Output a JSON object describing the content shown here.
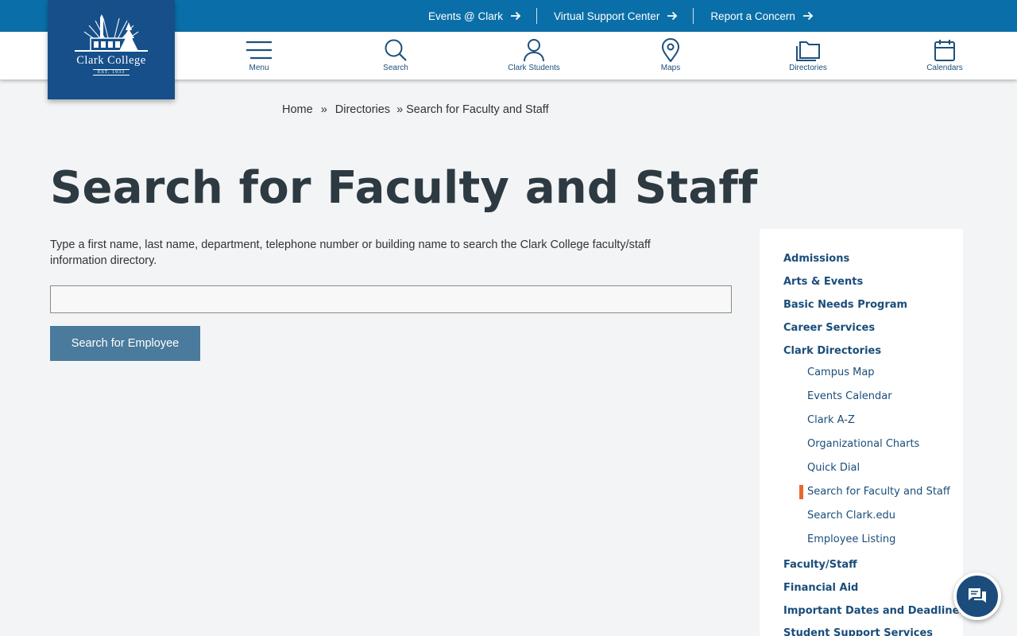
{
  "logo": {
    "name": "Clark College",
    "est": "EST. 1933"
  },
  "utility_links": [
    {
      "label": "Events @ Clark"
    },
    {
      "label": "Virtual Support Center"
    },
    {
      "label": "Report a Concern"
    }
  ],
  "nav": {
    "menu": "Menu",
    "search": "Search",
    "students": "Clark Students",
    "maps": "Maps",
    "directories": "Directories",
    "calendars": "Calendars"
  },
  "breadcrumb": {
    "home": "Home",
    "sep": "»",
    "directories": "Directories",
    "current": "Search for Faculty and Staff"
  },
  "page": {
    "title": "Search for Faculty and Staff",
    "intro": "Type a first name, last name, department, telephone number or building name to search the Clark College faculty/staff information directory.",
    "search_value": "",
    "search_button": "Search for Employee"
  },
  "sidebar": {
    "top_before": [
      "Admissions",
      "Arts & Events",
      "Basic Needs Program",
      "Career Services",
      "Clark Directories"
    ],
    "sub": [
      "Campus Map",
      "Events Calendar",
      "Clark A-Z",
      "Organizational Charts",
      "Quick Dial",
      "Search for Faculty and Staff",
      "Search Clark.edu",
      "Employee Listing"
    ],
    "active_sub": "Search for Faculty and Staff",
    "top_after": [
      "Faculty/Staff",
      "Financial Aid",
      "Important Dates and Deadlines",
      "Student Support Services"
    ]
  },
  "colors": {
    "utility_bar": "#0a6fa8",
    "brand_navy": "#164f8a",
    "link": "#1a4d7a",
    "active_marker": "#e8682c",
    "button": "#4a7a9c"
  },
  "icons": {
    "chat": "chat-bubbles-icon"
  }
}
